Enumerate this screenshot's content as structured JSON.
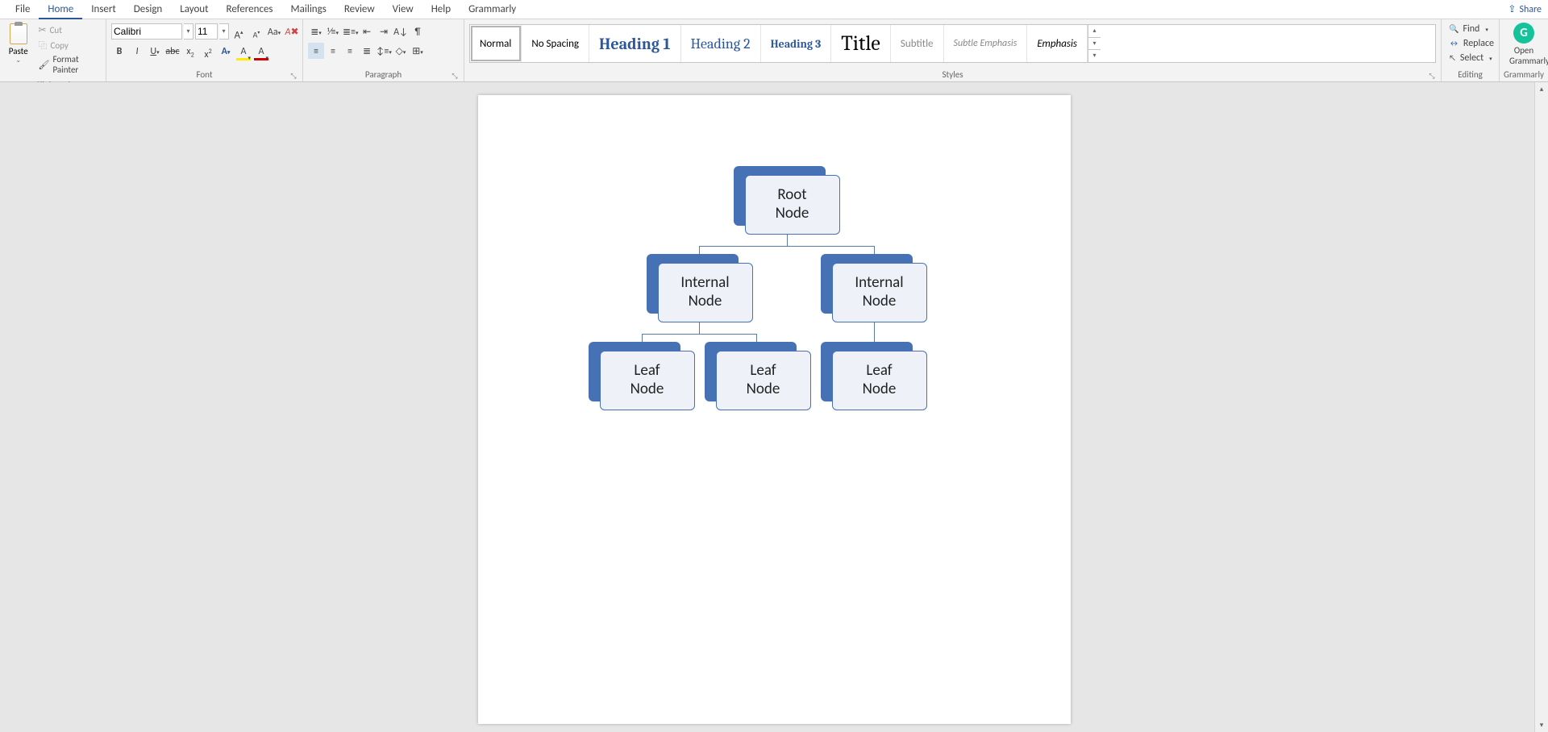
{
  "menu": {
    "file": "File",
    "home": "Home",
    "insert": "Insert",
    "design": "Design",
    "layout": "Layout",
    "references": "References",
    "mailings": "Mailings",
    "review": "Review",
    "view": "View",
    "help": "Help",
    "grammarly": "Grammarly",
    "share": "Share"
  },
  "clipboard": {
    "paste": "Paste",
    "cut": "Cut",
    "copy": "Copy",
    "format_painter": "Format Painter",
    "group_label": "Clipboard"
  },
  "font": {
    "name": "Calibri",
    "size": "11",
    "group_label": "Font"
  },
  "paragraph": {
    "group_label": "Paragraph"
  },
  "styles": {
    "normal": "Normal",
    "no_spacing": "No Spacing",
    "heading1": "Heading 1",
    "heading2": "Heading 2",
    "heading3": "Heading 3",
    "title": "Title",
    "subtitle": "Subtitle",
    "subtle_emphasis": "Subtle Emphasis",
    "emphasis": "Emphasis",
    "group_label": "Styles"
  },
  "editing": {
    "find": "Find",
    "replace": "Replace",
    "select": "Select",
    "group_label": "Editing"
  },
  "grammarly_group": {
    "open": "Open",
    "name": "Grammarly",
    "group_label": "Grammarly"
  },
  "diagram": {
    "root": "Root Node",
    "internal1": "Internal Node",
    "internal2": "Internal Node",
    "leaf1": "Leaf Node",
    "leaf2": "Leaf Node",
    "leaf3": "Leaf Node"
  }
}
